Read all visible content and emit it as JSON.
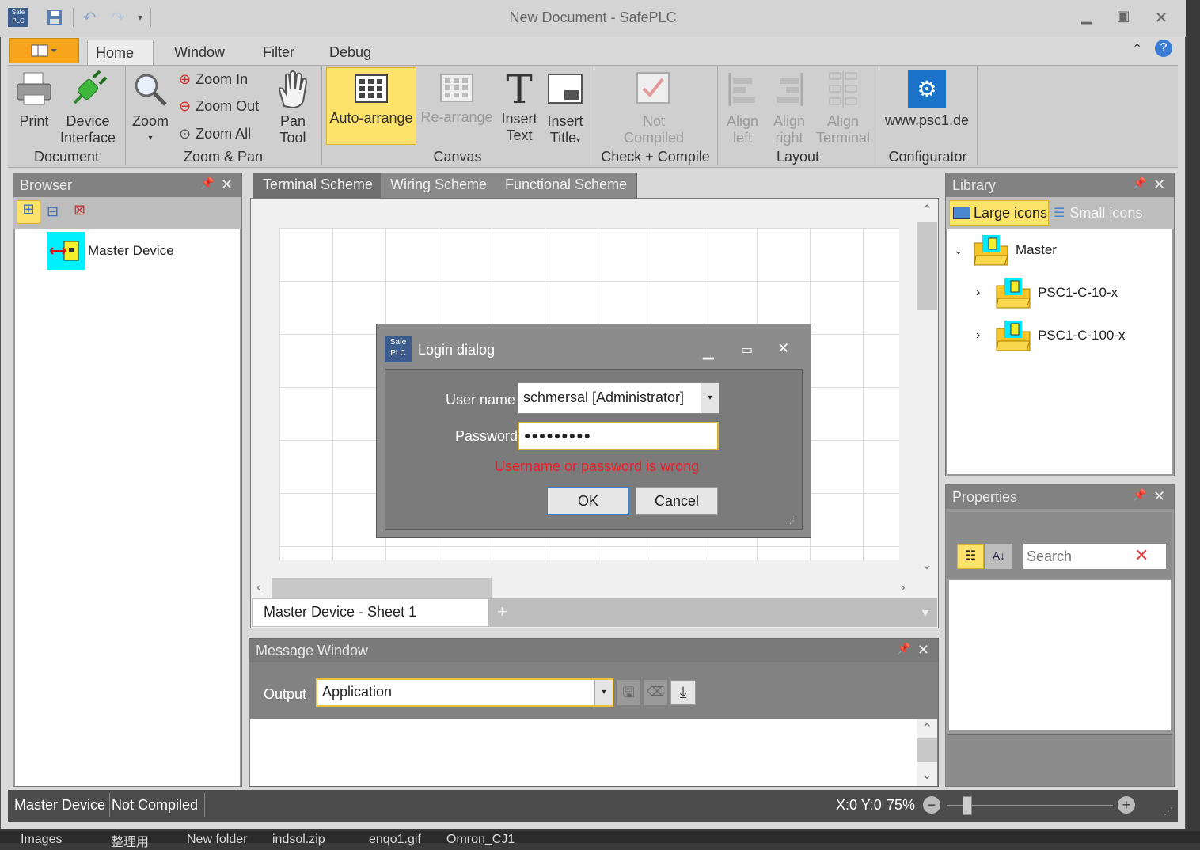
{
  "window": {
    "title": "New Document - SafePLC",
    "logo": "Safe PLC"
  },
  "quick_access": [
    "save-icon",
    "undo-icon",
    "redo-icon",
    "customize-icon"
  ],
  "tabs": [
    "Home",
    "Window",
    "Filter",
    "Debug"
  ],
  "ribbon": {
    "document": {
      "label": "Document",
      "print": "Print",
      "device_interface_1": "Device",
      "device_interface_2": "Interface"
    },
    "zoom_pan": {
      "label": "Zoom & Pan",
      "zoom": "Zoom",
      "zoom_in": "Zoom In",
      "zoom_out": "Zoom Out",
      "zoom_all": "Zoom All",
      "pan_1": "Pan",
      "pan_2": "Tool"
    },
    "canvas": {
      "label": "Canvas",
      "auto_arrange": "Auto-arrange",
      "re_arrange": "Re-arrange",
      "insert_text_1": "Insert",
      "insert_text_2": "Text",
      "insert_title_1": "Insert",
      "insert_title_2": "Title"
    },
    "check": {
      "label": "Check + Compile",
      "not_compiled_1": "Not",
      "not_compiled_2": "Compiled"
    },
    "layout": {
      "label": "Layout",
      "align_left_1": "Align",
      "align_left_2": "left",
      "align_right_1": "Align",
      "align_right_2": "right",
      "align_terminal_1": "Align",
      "align_terminal_2": "Terminal"
    },
    "configurator": {
      "label": "Configurator",
      "site": "www.psc1.de"
    }
  },
  "browser": {
    "title": "Browser",
    "item": "Master Device"
  },
  "doc_tabs": [
    "Terminal Scheme",
    "Wiring Scheme",
    "Functional Scheme"
  ],
  "sheet_tab": "Master Device - Sheet 1",
  "library": {
    "title": "Library",
    "large_icons": "Large icons",
    "small_icons": "Small icons",
    "tree": {
      "root": "Master",
      "children": [
        "PSC1-C-10-x",
        "PSC1-C-100-x"
      ]
    }
  },
  "properties": {
    "title": "Properties",
    "search_placeholder": "Search"
  },
  "message_window": {
    "title": "Message Window",
    "output_label": "Output",
    "output_value": "Application"
  },
  "status": {
    "device": "Master Device",
    "compile": "Not Compiled",
    "coords": "X:0 Y:0",
    "zoom": "75%"
  },
  "dialog": {
    "title": "Login dialog",
    "user_label": "User name",
    "user_value": "schmersal [Administrator]",
    "password_label": "Password",
    "password_value": "●●●●●●●●●",
    "error": "Username or password is wrong",
    "ok": "OK",
    "cancel": "Cancel"
  },
  "taskbar": [
    "Images",
    "整理用",
    "New folder",
    "indsol.zip",
    "enqo1.gif",
    "Omron_CJ1"
  ],
  "colors": {
    "accent_orange": "#f7a51a",
    "auto_arrange": "#fde26b",
    "error": "#e8202a",
    "panel_header": "#828282"
  }
}
